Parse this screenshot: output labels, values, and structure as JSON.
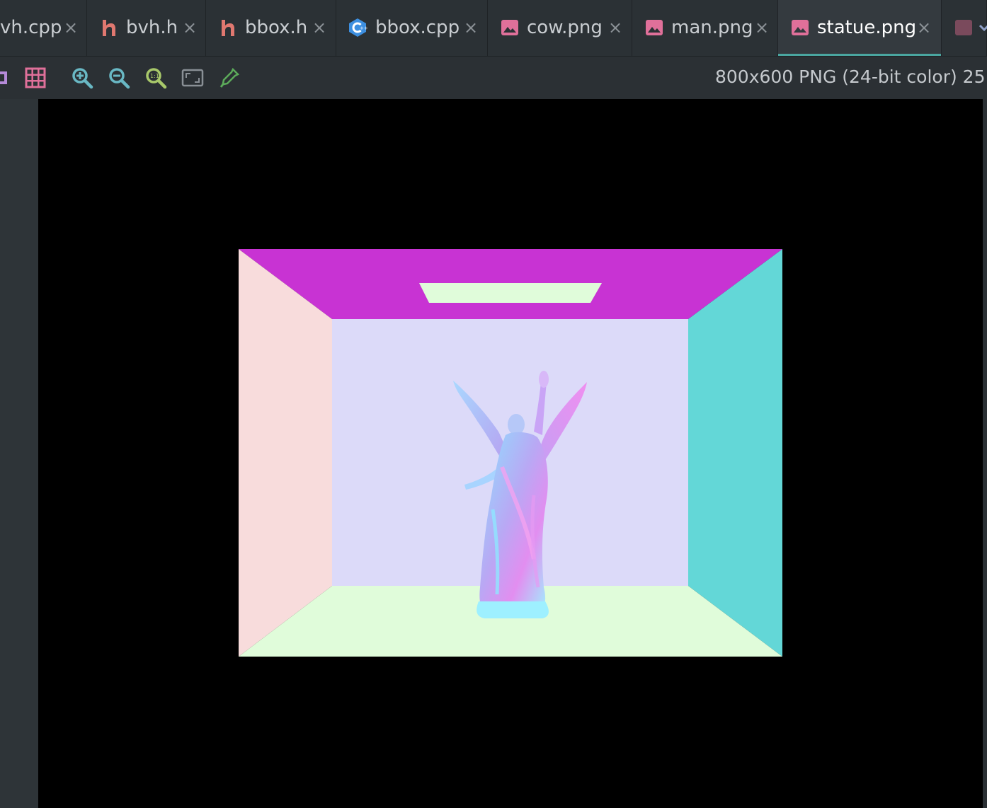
{
  "tabs": [
    {
      "label": "vh.cpp",
      "icon": "cpp-file-icon",
      "active": false
    },
    {
      "label": "bvh.h",
      "icon": "header-file-icon",
      "active": false
    },
    {
      "label": "bbox.h",
      "icon": "header-file-icon",
      "active": false
    },
    {
      "label": "bbox.cpp",
      "icon": "cpp-file-icon",
      "active": false
    },
    {
      "label": "cow.png",
      "icon": "image-file-icon",
      "active": false
    },
    {
      "label": "man.png",
      "icon": "image-file-icon",
      "active": false
    },
    {
      "label": "statue.png",
      "icon": "image-file-icon",
      "active": true
    }
  ],
  "tab_close_glyph": "×",
  "toolbar": {
    "tools": [
      "background-toggle-icon",
      "grid-icon",
      "zoom-in-icon",
      "zoom-out-icon",
      "actual-size-icon",
      "fit-to-window-icon",
      "color-picker-icon"
    ],
    "image_info": "800x600 PNG (24-bit color) 25"
  },
  "colors": {
    "ceiling": "#c833d3",
    "back_wall": "#dcdaf9",
    "left_wall": "#f8dcdc",
    "right_wall": "#63d7d7",
    "floor": "#e0fcda",
    "light": "#e0fcda",
    "accent": "#4aa6a0",
    "header_icon": "#e07870",
    "cpp_icon": "#3d8fe0",
    "image_icon": "#e0709a"
  }
}
